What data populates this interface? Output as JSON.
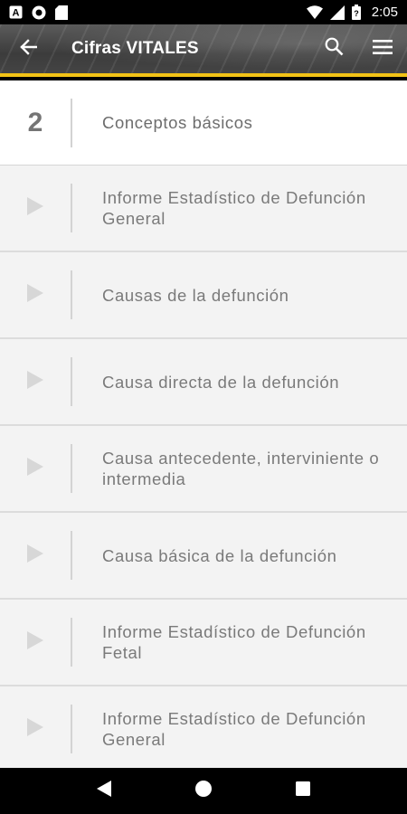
{
  "status_bar": {
    "time": "2:05",
    "left_icons": [
      "app-a-icon",
      "circle-app-icon",
      "sd-card-icon"
    ],
    "right_icons": [
      "wifi-icon",
      "signal-icon",
      "battery-icon"
    ]
  },
  "app_bar": {
    "title": "Cifras VITALES",
    "accent_color": "#f2c316"
  },
  "section": {
    "number": "2",
    "title": "Conceptos básicos"
  },
  "items": [
    {
      "label": "Informe Estadístico de Defunción General"
    },
    {
      "label": "Causas de la defunción"
    },
    {
      "label": "Causa directa de la defunción"
    },
    {
      "label": "Causa antecedente, interviniente o intermedia"
    },
    {
      "label": "Causa básica de la defunción"
    },
    {
      "label": "Informe Estadístico de Defunción Fetal"
    },
    {
      "label": "Informe Estadístico de Defunción General"
    }
  ],
  "nav_bar": {
    "buttons": [
      "back-triangle-icon",
      "home-circle-icon",
      "recents-square-icon"
    ]
  }
}
